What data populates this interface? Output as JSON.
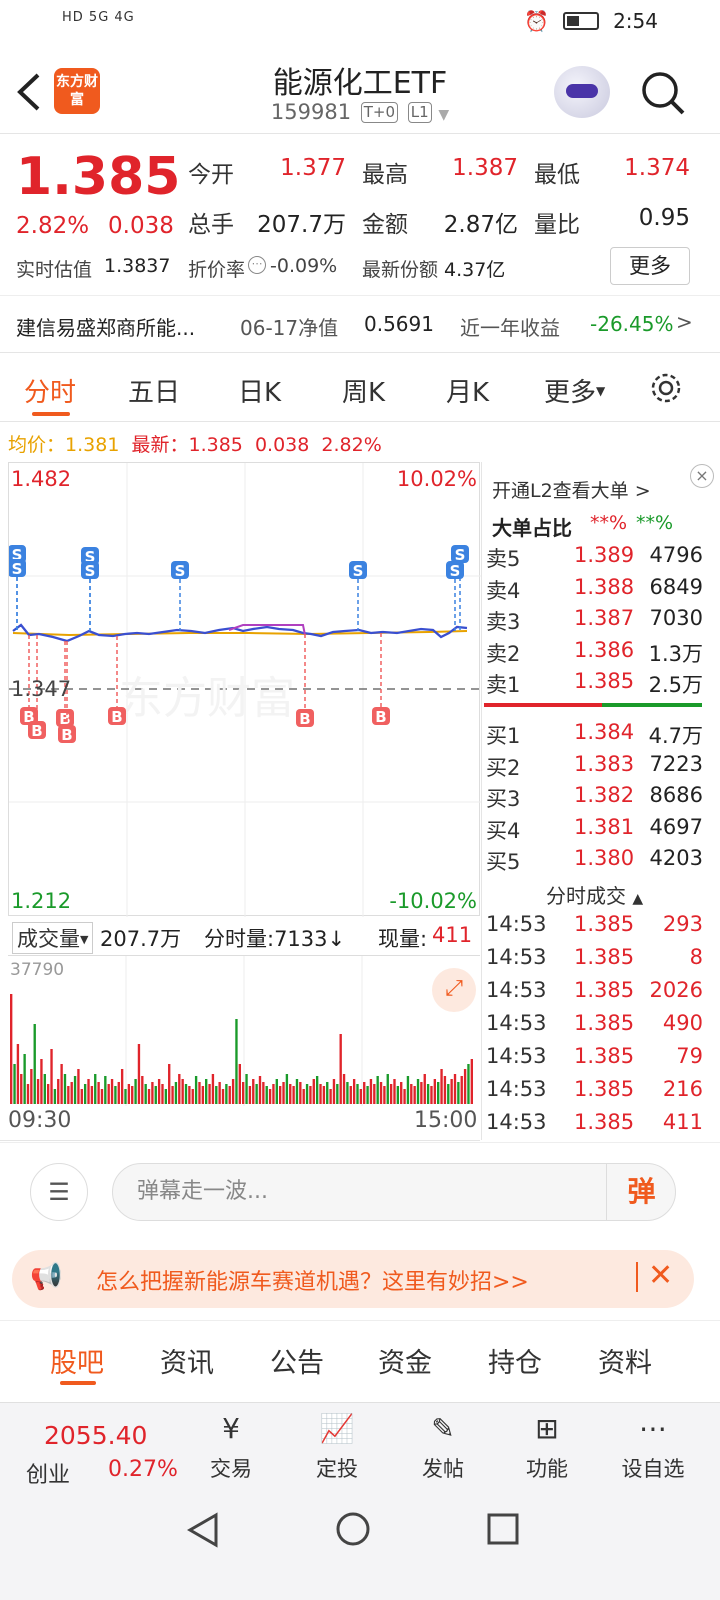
{
  "status_bar": {
    "time": "2:54",
    "icons": "HD 5G 4G"
  },
  "header": {
    "logo_text": "东方财富",
    "title": "能源化工ETF",
    "code": "159981",
    "tag1": "T+0",
    "tag2": "L1"
  },
  "quote": {
    "price": "1.385",
    "change_pct": "2.82%",
    "change": "0.038",
    "open_label": "今开",
    "open": "1.377",
    "high_label": "最高",
    "high": "1.387",
    "low_label": "最低",
    "low": "1.374",
    "volume_label": "总手",
    "volume": "207.7万",
    "amount_label": "金额",
    "amount": "2.87亿",
    "vol_ratio_label": "量比",
    "vol_ratio": "0.95",
    "iopv_label": "实时估值",
    "iopv": "1.3837",
    "discount_label": "折价率",
    "discount": "-0.09%",
    "shares_label": "最新份额",
    "shares": "4.37亿",
    "more_label": "更多",
    "fund_name": "建信易盛郑商所能...",
    "nav_label": "06-17净值",
    "nav": "0.5691",
    "yield_label": "近一年收益",
    "yield": "-26.45%"
  },
  "period_tabs": [
    "分时",
    "五日",
    "日K",
    "周K",
    "月K",
    "更多"
  ],
  "avg_row": {
    "avg_label": "均价：",
    "avg": "1.381",
    "latest_label": "最新：",
    "latest": "1.385",
    "chg": "0.038",
    "pct": "2.82%"
  },
  "chart": {
    "y_top": "1.482",
    "y_bottom": "1.212",
    "y_ref": "1.347",
    "pct_top": "10.02%",
    "pct_bottom": "-10.02%",
    "x_start": "09:30",
    "x_end": "15:00",
    "watermark": "东方财富",
    "buy_marker": "B",
    "sell_marker": "S"
  },
  "volume_bar": {
    "label": "成交量",
    "total": "207.7万",
    "minute_vol": "分时量:7133↓",
    "now_label": "现量:",
    "now": "411",
    "max": "37790"
  },
  "order_book": {
    "l2_link": "开通L2查看大单",
    "big_label": "大单占比",
    "big_buy": "**%",
    "big_sell": "**%",
    "asks": [
      {
        "label": "卖5",
        "price": "1.389",
        "vol": "4796"
      },
      {
        "label": "卖4",
        "price": "1.388",
        "vol": "6849"
      },
      {
        "label": "卖3",
        "price": "1.387",
        "vol": "7030"
      },
      {
        "label": "卖2",
        "price": "1.386",
        "vol": "1.3万"
      },
      {
        "label": "卖1",
        "price": "1.385",
        "vol": "2.5万"
      }
    ],
    "bids": [
      {
        "label": "买1",
        "price": "1.384",
        "vol": "4.7万"
      },
      {
        "label": "买2",
        "price": "1.383",
        "vol": "7223"
      },
      {
        "label": "买3",
        "price": "1.382",
        "vol": "8686"
      },
      {
        "label": "买4",
        "price": "1.381",
        "vol": "4697"
      },
      {
        "label": "买5",
        "price": "1.380",
        "vol": "4203"
      }
    ],
    "ticks_title": "分时成交",
    "ticks": [
      {
        "time": "14:53",
        "price": "1.385",
        "vol": "293"
      },
      {
        "time": "14:53",
        "price": "1.385",
        "vol": "8"
      },
      {
        "time": "14:53",
        "price": "1.385",
        "vol": "2026"
      },
      {
        "time": "14:53",
        "price": "1.385",
        "vol": "490"
      },
      {
        "time": "14:53",
        "price": "1.385",
        "vol": "79"
      },
      {
        "time": "14:53",
        "price": "1.385",
        "vol": "216"
      },
      {
        "time": "14:53",
        "price": "1.385",
        "vol": "411"
      }
    ]
  },
  "danmu": {
    "placeholder": "弹幕走一波...",
    "button": "弹"
  },
  "promo": {
    "text": "怎么把握新能源车赛道机遇？这里有妙招>>"
  },
  "section_tabs": [
    "股吧",
    "资讯",
    "公告",
    "资金",
    "持仓",
    "资料"
  ],
  "bottom_bar": {
    "index_value": "2055.40",
    "index_name": "创业",
    "index_pct": "0.27%",
    "items": [
      "交易",
      "定投",
      "发帖",
      "功能",
      "设自选"
    ]
  },
  "colors": {
    "accent": "#f05a1e",
    "up": "#e0242b",
    "down": "#1a9a2a",
    "avg_line": "#e8a200",
    "price_line": "#3a4fd0"
  }
}
